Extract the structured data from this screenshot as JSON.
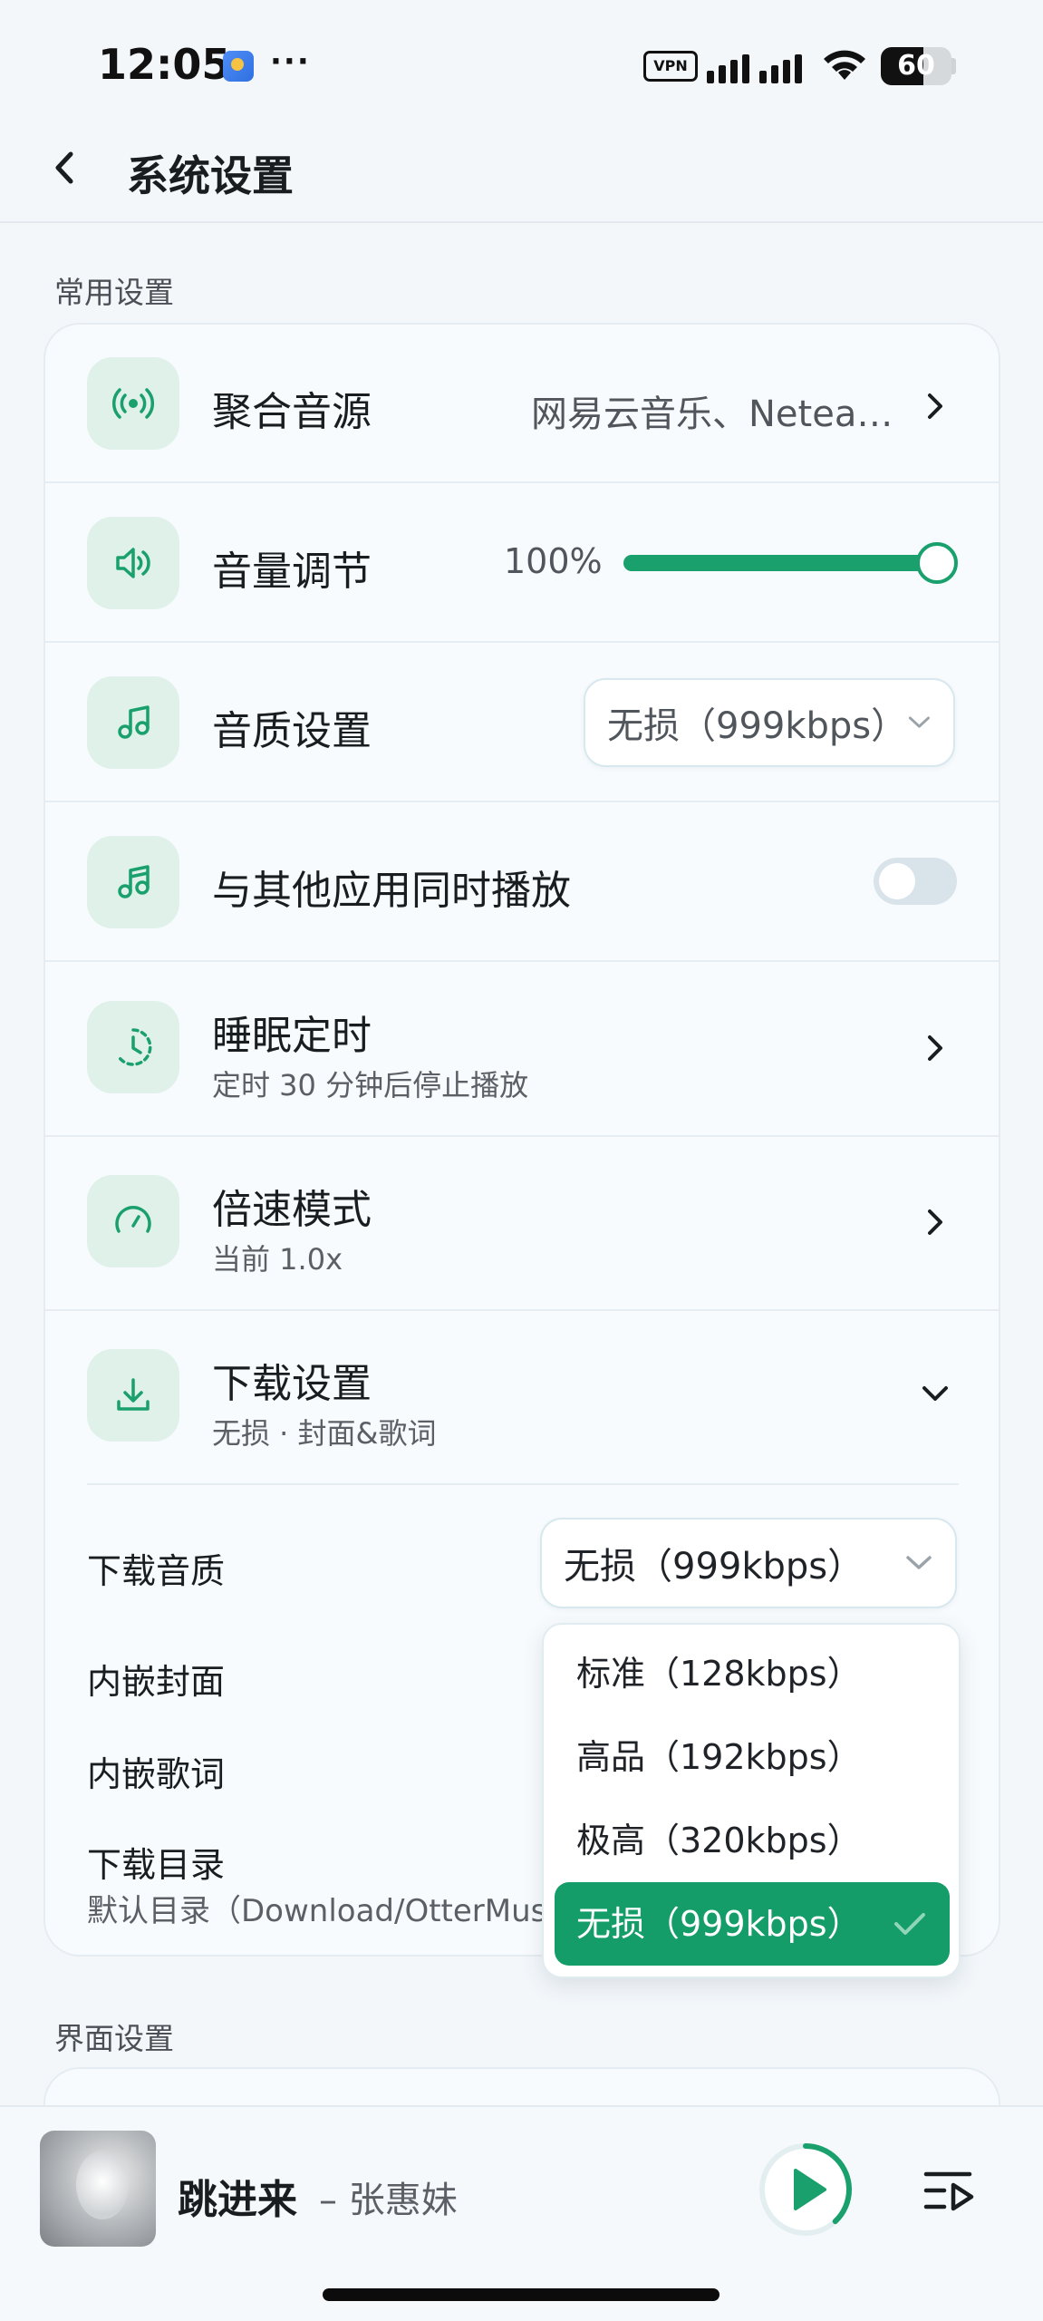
{
  "status_bar": {
    "time": "12:05",
    "more": "···",
    "vpn": "VPN",
    "battery": "60",
    "battery_level": 0.6
  },
  "header": {
    "back_icon": "chevron-left-icon",
    "title": "系统设置"
  },
  "sections": {
    "common": "常用设置",
    "interface": "界面设置"
  },
  "settings": {
    "source": {
      "title": "聚合音源",
      "value": "网易云音乐、Netea…",
      "icon": "broadcast-icon"
    },
    "volume": {
      "title": "音量调节",
      "value_text": "100%",
      "level": 1.0,
      "icon": "speaker-icon"
    },
    "quality": {
      "title": "音质设置",
      "selected": "无损（999kbps）",
      "icon": "music-note-icon"
    },
    "mix": {
      "title": "与其他应用同时播放",
      "enabled": false,
      "icon": "music-note-icon"
    },
    "sleep": {
      "title": "睡眠定时",
      "subtitle": "定时 30 分钟后停止播放",
      "icon": "timer-icon"
    },
    "speed": {
      "title": "倍速模式",
      "subtitle": "当前 1.0x",
      "icon": "gauge-icon"
    },
    "download": {
      "title": "下载设置",
      "subtitle": "无损 · 封面&歌词",
      "icon": "download-icon",
      "quality_label": "下载音质",
      "quality_selected": "无损（999kbps）",
      "cover_label": "内嵌封面",
      "lyrics_label": "内嵌歌词",
      "dir_label": "下载目录",
      "dir_value": "默认目录（Download/OtterMusi"
    }
  },
  "dropdown": {
    "options": [
      {
        "label": "标准（128kbps）",
        "selected": false
      },
      {
        "label": "高品（192kbps）",
        "selected": false
      },
      {
        "label": "极高（320kbps）",
        "selected": false
      },
      {
        "label": "无损（999kbps）",
        "selected": true
      }
    ]
  },
  "player": {
    "title": "跳进来",
    "artist": "– 张惠妹",
    "progress": 0.38
  },
  "colors": {
    "accent": "#1aa06d",
    "icon_bg": "#e0f1ea",
    "background": "#f3f7fa"
  }
}
